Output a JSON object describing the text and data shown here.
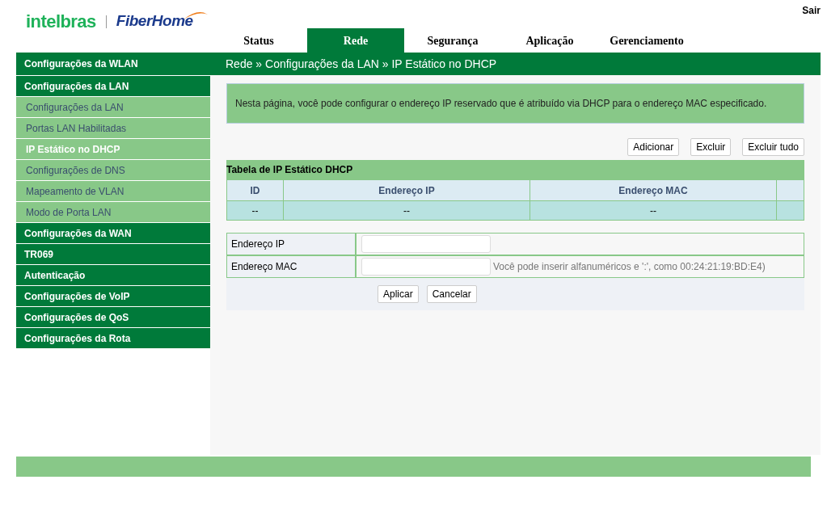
{
  "header": {
    "logo": {
      "brand": "intelbras",
      "partner": "FiberHome"
    },
    "logout": "Sair"
  },
  "tabs": [
    {
      "label": "Status",
      "selected": false
    },
    {
      "label": "Rede",
      "selected": true
    },
    {
      "label": "Segurança",
      "selected": false
    },
    {
      "label": "Aplicação",
      "selected": false
    },
    {
      "label": "Gerenciamento",
      "selected": false
    }
  ],
  "breadcrumb": "Rede » Configurações da LAN » IP Estático no DHCP",
  "sidebar": {
    "items": [
      {
        "label": "Configurações da WLAN"
      },
      {
        "label": "Configurações da LAN",
        "children": [
          {
            "label": "Configurações da LAN",
            "selected": false
          },
          {
            "label": "Portas LAN Habilitadas",
            "selected": false
          },
          {
            "label": "IP Estático no DHCP",
            "selected": true
          },
          {
            "label": "Configurações de DNS",
            "selected": false
          },
          {
            "label": "Mapeamento de VLAN",
            "selected": false
          },
          {
            "label": "Modo de Porta LAN",
            "selected": false
          }
        ]
      },
      {
        "label": "Configurações da WAN"
      },
      {
        "label": "TR069"
      },
      {
        "label": "Autenticação"
      },
      {
        "label": "Configurações de VoIP"
      },
      {
        "label": "Configurações de QoS"
      },
      {
        "label": "Configurações da Rota"
      }
    ]
  },
  "info": "Nesta página, você pode configurar o endereço IP reservado que é atribuído via DHCP para o endereço MAC especificado.",
  "table_actions": [
    "Adicionar",
    "Excluir",
    "Excluir tudo"
  ],
  "table": {
    "title": "Tabela de IP Estático DHCP",
    "columns": [
      "ID",
      "Endereço IP",
      "Endereço MAC"
    ],
    "rows": [
      [
        "--",
        "--",
        "--"
      ]
    ]
  },
  "form": {
    "fields": [
      {
        "label": "Endereço IP"
      },
      {
        "label": "Endereço MAC",
        "hint": "Você pode inserir alfanuméricos e ':', como 00:24:21:19:BD:E4)"
      }
    ],
    "buttons": [
      "Aplicar",
      "Cancelar"
    ]
  }
}
